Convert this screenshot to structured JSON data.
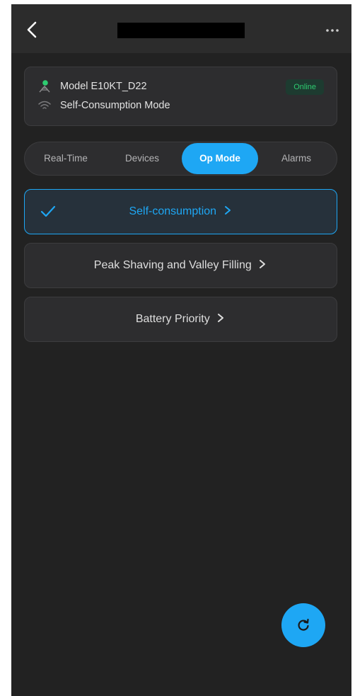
{
  "header": {
    "back_icon": "chevron-left-icon",
    "more_icon": "more-horizontal-icon"
  },
  "device": {
    "model": "Model E10KT_D22",
    "mode": "Self-Consumption Mode",
    "status": "Online",
    "device_icon": "inverter-icon",
    "signal_icon": "wifi-icon"
  },
  "tabs": [
    {
      "label": "Real-Time"
    },
    {
      "label": "Devices"
    },
    {
      "label": "Op Mode",
      "active": true
    },
    {
      "label": "Alarms"
    }
  ],
  "modes": [
    {
      "label": "Self-consumption",
      "selected": true
    },
    {
      "label": "Peak Shaving and Valley Filling",
      "selected": false
    },
    {
      "label": "Battery Priority",
      "selected": false
    }
  ],
  "fab": {
    "icon": "refresh-icon"
  },
  "colors": {
    "accent": "#1ea7f4",
    "online": "#2ecc71",
    "background": "#222222"
  }
}
